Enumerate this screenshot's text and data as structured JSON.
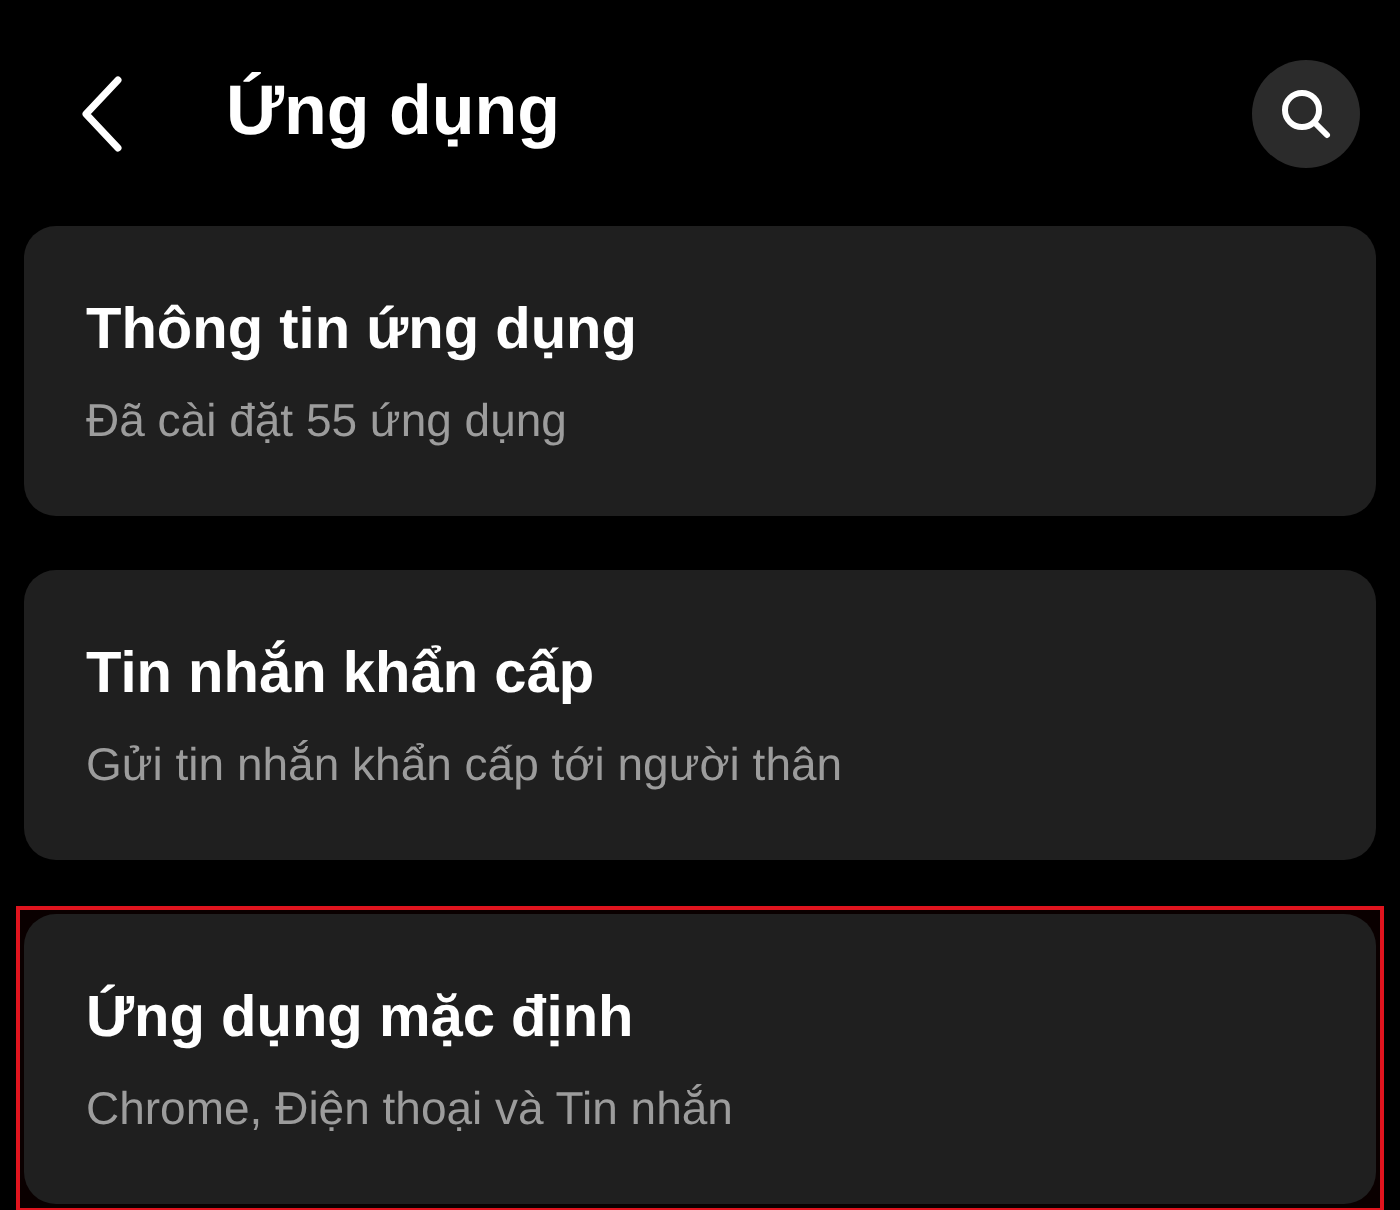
{
  "header": {
    "title": "Ứng dụng"
  },
  "items": [
    {
      "title": "Thông tin ứng dụng",
      "subtitle": "Đã cài đặt 55 ứng dụng",
      "highlighted": false
    },
    {
      "title": "Tin nhắn khẩn cấp",
      "subtitle": "Gửi tin nhắn khẩn cấp tới người thân",
      "highlighted": false
    },
    {
      "title": "Ứng dụng mặc định",
      "subtitle": "Chrome, Điện thoại và Tin nhắn",
      "highlighted": true
    }
  ]
}
